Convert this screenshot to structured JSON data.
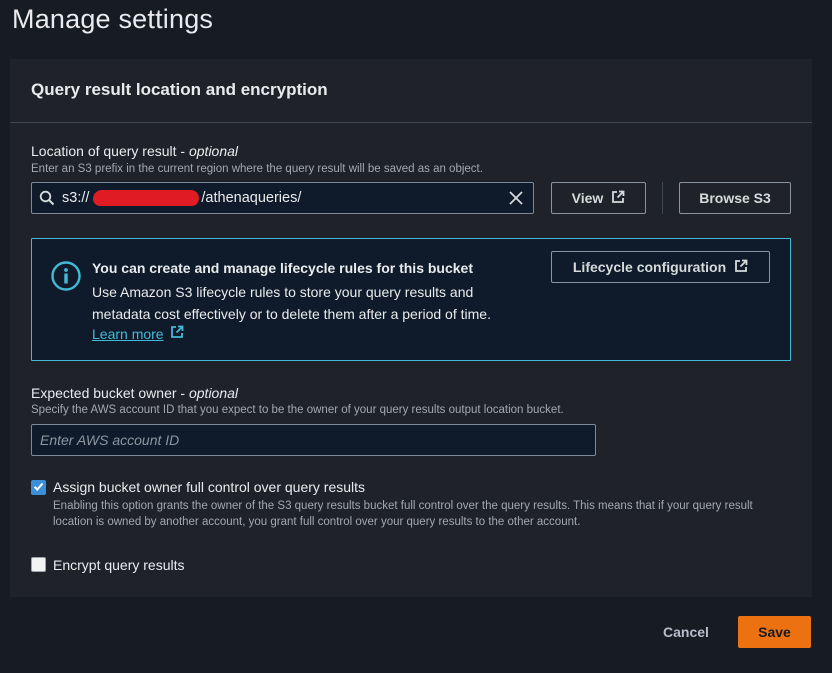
{
  "page_title": "Manage settings",
  "section": {
    "title": "Query result location and encryption"
  },
  "query_location": {
    "label": "Location of query result - ",
    "label_optional": "optional",
    "description": "Enter an S3 prefix in the current region where the query result will be saved as an object.",
    "value_prefix": "s3://",
    "value_suffix": "/athenaqueries/",
    "view_label": "View",
    "browse_label": "Browse S3"
  },
  "info": {
    "title": "You can create and manage lifecycle rules for this bucket",
    "body": "Use Amazon S3 lifecycle rules to store your query results and metadata cost effectively or to delete them after a period of time.",
    "link": "Learn more",
    "button_label": "Lifecycle configuration"
  },
  "bucket_owner": {
    "label": "Expected bucket owner - ",
    "label_optional": "optional",
    "description": "Specify the AWS account ID that you expect to be the owner of your query results output location bucket.",
    "placeholder": "Enter AWS account ID",
    "value": ""
  },
  "full_control": {
    "checked": true,
    "label": "Assign bucket owner full control over query results",
    "description": "Enabling this option grants the owner of the S3 query results bucket full control over the query results. This means that if your query result location is owned by another account, you grant full control over your query results to the other account."
  },
  "encrypt": {
    "checked": false,
    "label": "Encrypt query results"
  },
  "footer": {
    "cancel_label": "Cancel",
    "save_label": "Save"
  },
  "colors": {
    "accent": "#ec7211",
    "link": "#44b9d6",
    "checkbox": "#3b8fd9",
    "redaction": "#e01b24"
  },
  "icons": [
    "search-icon",
    "clear-icon",
    "external-link-icon",
    "info-icon",
    "check-icon"
  ]
}
